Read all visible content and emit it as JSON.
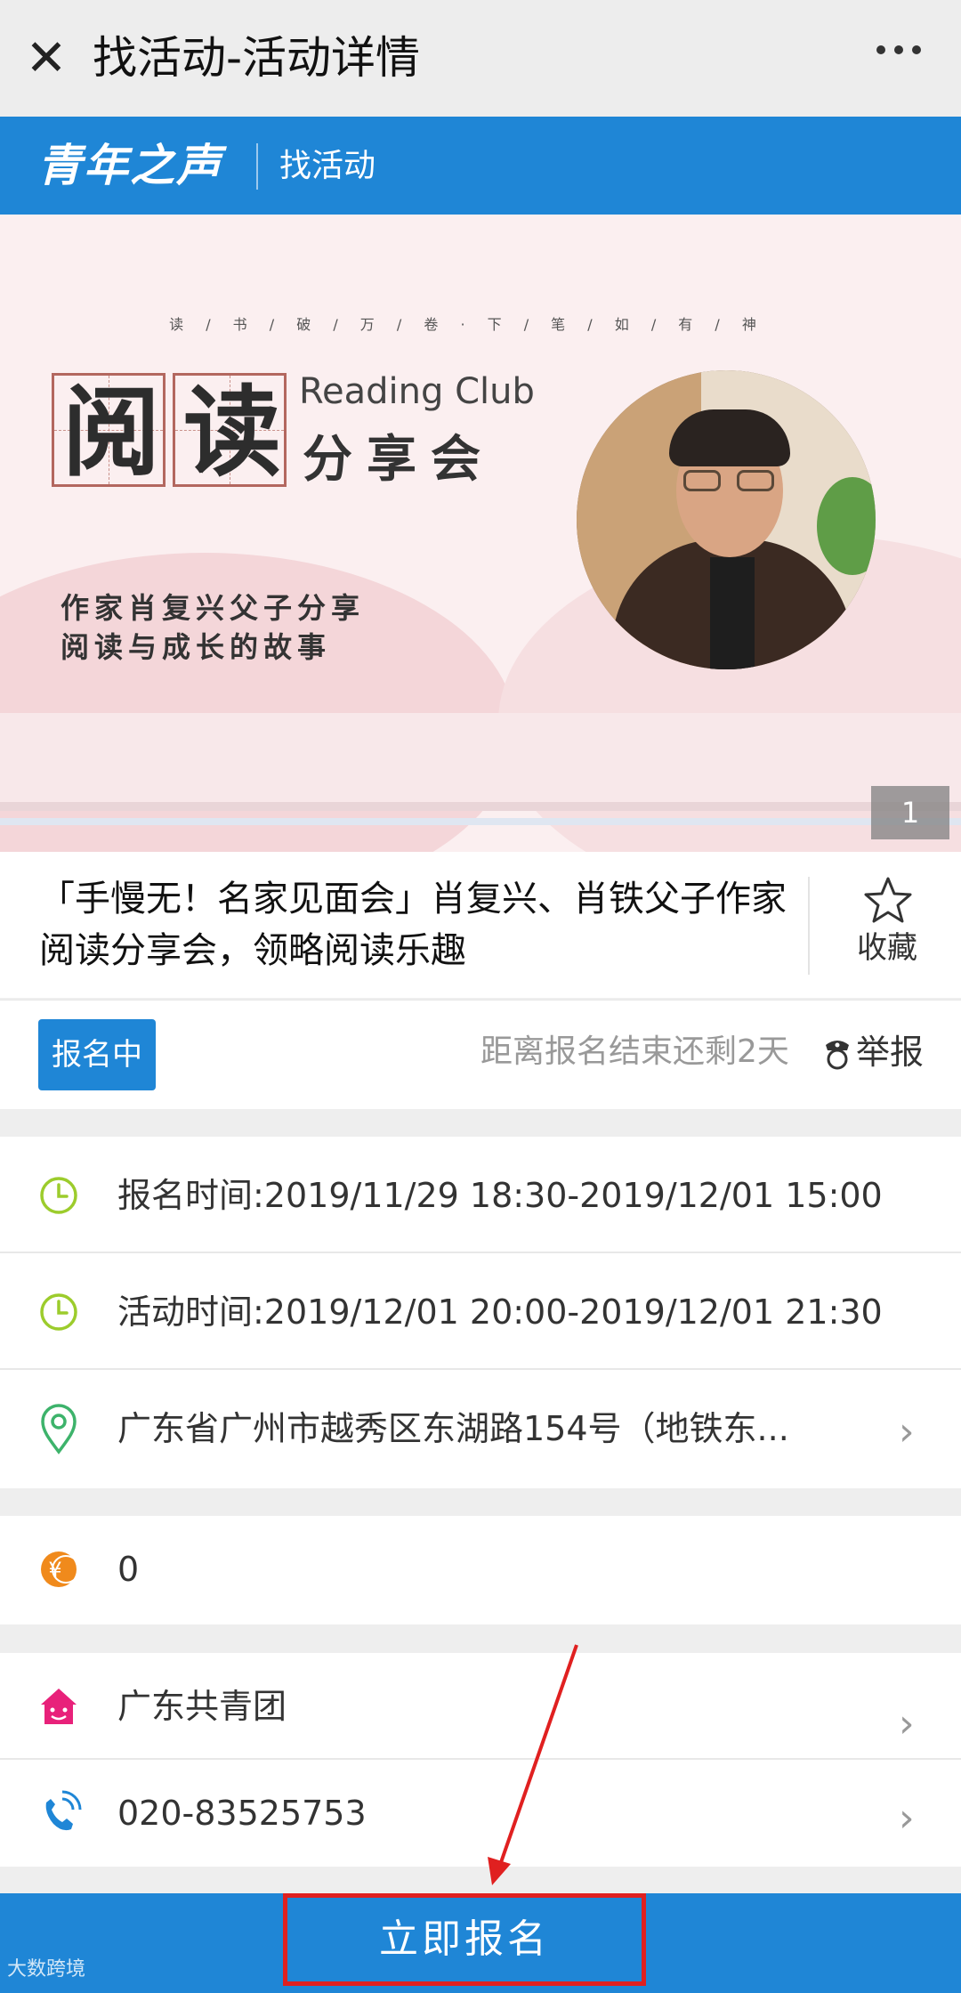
{
  "topbar": {
    "close_glyph": "✕",
    "title": "找活动-活动详情",
    "more_icon": "more-icon"
  },
  "brand": {
    "logo": "青年之声",
    "section": "找活动"
  },
  "banner": {
    "motto": "读 / 书 / 破 / 万 / 卷 · 下 / 笔 / 如 / 有 / 神",
    "char1": "阅",
    "char2": "读",
    "club_en": "Reading Club",
    "club_cn": "分享会",
    "desc_line1": "作家肖复兴父子分享",
    "desc_line2": "阅读与成长的故事",
    "counter": "1"
  },
  "event": {
    "title": "「手慢无！名家见面会」肖复兴、肖铁父子作家阅读分享会，领略阅读乐趣",
    "favorite_label": "收藏"
  },
  "status": {
    "badge": "报名中",
    "remaining": "距离报名结束还剩2天",
    "report": "举报"
  },
  "info": {
    "signup_time": "报名时间:2019/11/29 18:30-2019/12/01 15:00",
    "event_time": "活动时间:2019/12/01 20:00-2019/12/01 21:30",
    "address": "广东省广州市越秀区东湖路154号（地铁东...",
    "fee": "0",
    "organizer": "广东共青团",
    "phone": "020-83525753"
  },
  "bottom": {
    "signup_button": "立即报名",
    "watermark": "大数跨境"
  },
  "colors": {
    "brand_blue": "#1f86d6",
    "clock_green": "#9ccc2c",
    "pin_green": "#3db36b",
    "coin_orange": "#f08a1c",
    "home_pink": "#e8217a",
    "phone_blue": "#1f86d6",
    "annotation_red": "#e02020"
  }
}
